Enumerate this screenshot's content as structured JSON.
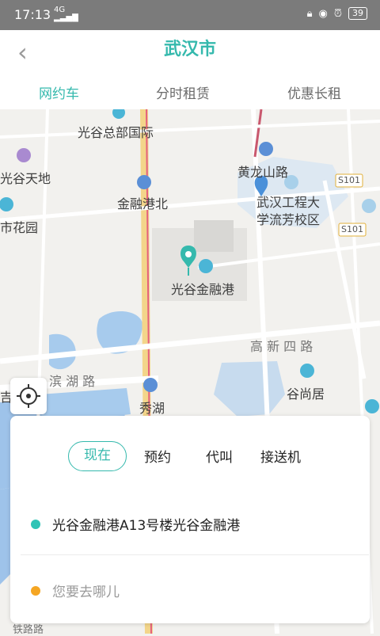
{
  "status_bar": {
    "time": "17:13",
    "network": "4G",
    "battery": "39"
  },
  "header": {
    "title": "武汉市",
    "tabs": [
      {
        "label": "网约车",
        "active": true
      },
      {
        "label": "分时租赁",
        "active": false
      },
      {
        "label": "优惠长租",
        "active": false
      }
    ]
  },
  "map": {
    "labels": {
      "guanggu_hq": "光谷总部国际",
      "guanggu_tiandi": "光谷天地",
      "city_garden": "城市花园",
      "jinronggang_bei": "金融港北",
      "huanglongshan": "黄龙山路",
      "wuhan_gcdx_1": "武汉工程大",
      "wuhan_gcdx_2": "学流芳校区",
      "s101_top": "S101",
      "s101_right": "S101",
      "guanggu_jinronggang": "光谷金融港",
      "gaoxin_4": "高 新 四 路",
      "binhu": "滨 湖 路",
      "gushangju": "谷尚居",
      "xiuhu": "秀湖",
      "ji": "吉",
      "bottom_road": "铁路路"
    }
  },
  "panel": {
    "modes": [
      "现在",
      "预约",
      "代叫",
      "接送机"
    ],
    "pickup": "光谷金融港A13号楼光谷金融港",
    "destination_placeholder": "您要去哪儿",
    "colors": {
      "accent": "#35b9ad",
      "pickup_dot": "#2ec4b6",
      "dest_dot": "#f5a623"
    }
  }
}
